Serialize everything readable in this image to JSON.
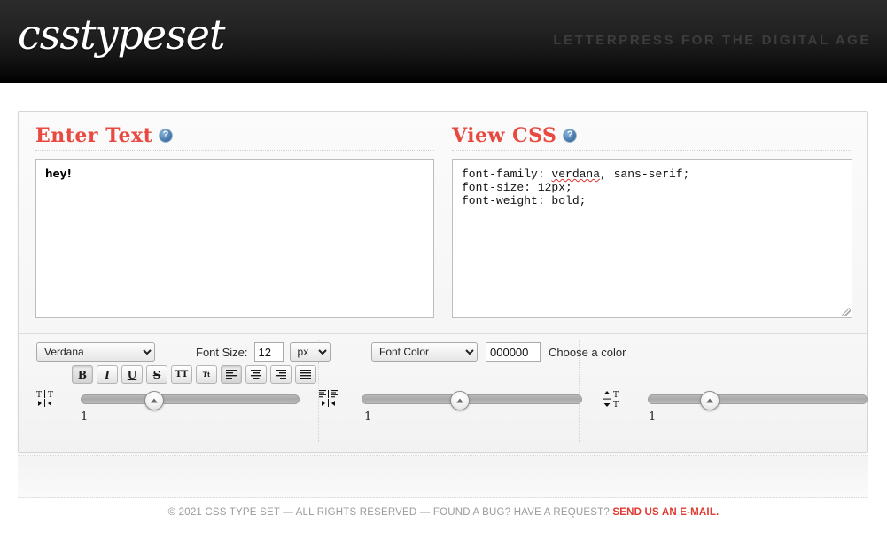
{
  "header": {
    "logo": "csstypeset",
    "tagline": "Letterpress for the Digital Age"
  },
  "enter_text": {
    "title": "Enter Text",
    "help_icon": "help-circle-icon",
    "value": "hey!"
  },
  "view_css": {
    "title": "View CSS",
    "help_icon": "help-circle-icon",
    "lines": [
      "font-family: verdana, sans-serif;",
      "font-size: 12px;",
      "font-weight: bold;"
    ],
    "font_family_prefix": "font-family: ",
    "font_family_value": "verdana",
    "font_family_suffix": ", sans-serif;",
    "font_size_line": "font-size: 12px;",
    "font_weight_line": "font-weight: bold;"
  },
  "toolbar": {
    "font_family_selected": "Verdana",
    "font_size_label": "Font Size:",
    "font_size_value": "12",
    "font_size_unit": "px",
    "font_color_selected": "Font Color",
    "font_color_value": "000000",
    "choose_color_label": "Choose a color",
    "format_buttons": [
      {
        "name": "bold-button",
        "glyph": "B",
        "active": true
      },
      {
        "name": "italic-button",
        "glyph": "I",
        "active": false
      },
      {
        "name": "underline-button",
        "glyph": "U",
        "active": false
      },
      {
        "name": "strikethrough-button",
        "glyph": "S",
        "active": false
      },
      {
        "name": "uppercase-button",
        "glyph": "TT",
        "active": false
      },
      {
        "name": "smallcaps-button",
        "glyph": "Tt",
        "active": false
      },
      {
        "name": "align-left-button",
        "glyph": "",
        "active": true
      },
      {
        "name": "align-center-button",
        "glyph": "",
        "active": false
      },
      {
        "name": "align-right-button",
        "glyph": "",
        "active": false
      },
      {
        "name": "align-justify-button",
        "glyph": "",
        "active": false
      }
    ],
    "sliders": [
      {
        "name": "letter-spacing-slider",
        "icon": "letter-spacing-icon",
        "value": "1",
        "position_pct": 30
      },
      {
        "name": "word-spacing-slider",
        "icon": "word-spacing-icon",
        "value": "1",
        "position_pct": 42
      },
      {
        "name": "line-height-slider",
        "icon": "line-height-icon",
        "value": "1",
        "position_pct": 25
      }
    ]
  },
  "footer": {
    "text": "© 2021 CSS TYPE SET — ALL RIGHTS RESERVED — FOUND A BUG? HAVE A REQUEST? ",
    "link": "SEND US AN E-MAIL."
  },
  "colors": {
    "accent_red": "#e84a41",
    "header_bg": "#111111",
    "tagline": "#3d3d3d",
    "footer_text": "#9b9b9b",
    "footer_link": "#e03a32"
  }
}
